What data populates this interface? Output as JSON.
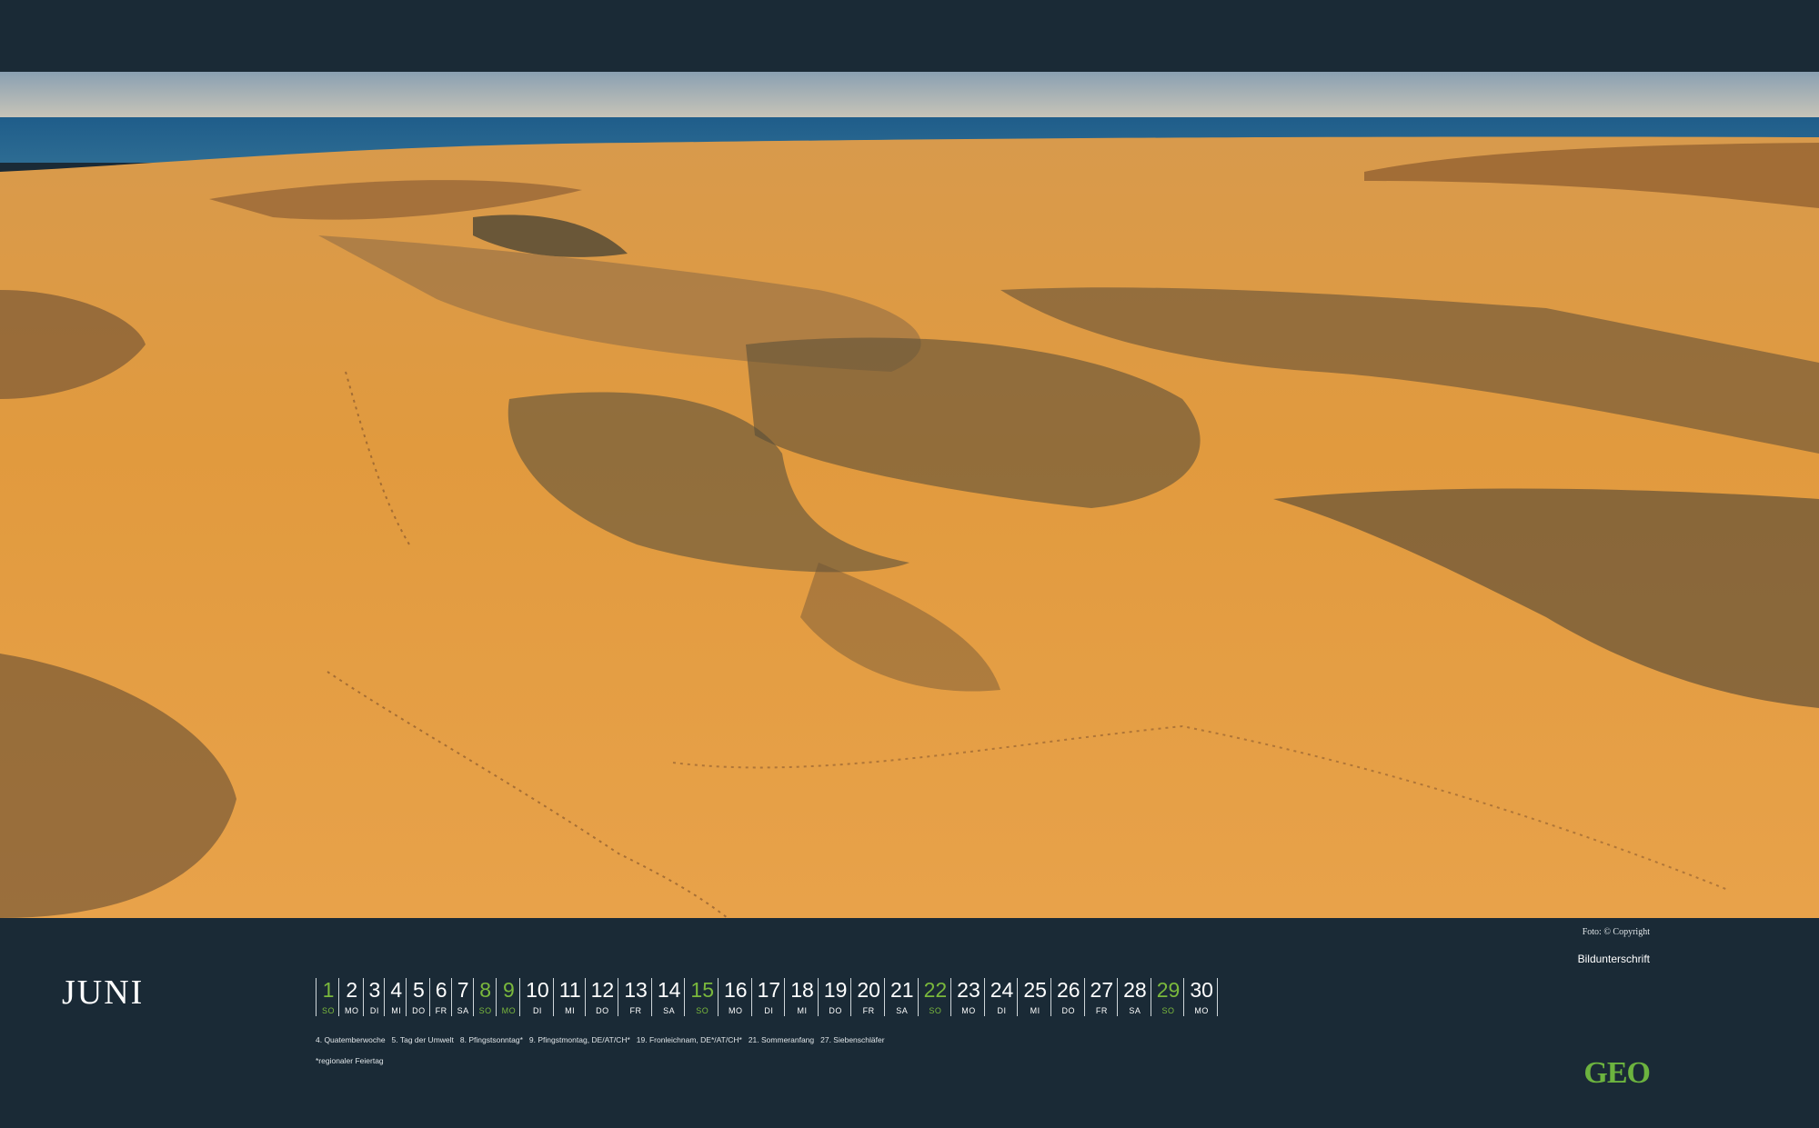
{
  "month": "JUNI",
  "photo_credit": "Foto: © Copyright",
  "caption": "Bildunterschrift",
  "logo": "GEO",
  "colors": {
    "background": "#1a2a36",
    "sunday": "#7ab83c",
    "logo": "#6cb33f"
  },
  "days": [
    {
      "n": "1",
      "wd": "SO",
      "sunday": true
    },
    {
      "n": "2",
      "wd": "MO"
    },
    {
      "n": "3",
      "wd": "DI"
    },
    {
      "n": "4",
      "wd": "MI"
    },
    {
      "n": "5",
      "wd": "DO"
    },
    {
      "n": "6",
      "wd": "FR"
    },
    {
      "n": "7",
      "wd": "SA"
    },
    {
      "n": "8",
      "wd": "SO",
      "sunday": true
    },
    {
      "n": "9",
      "wd": "MO",
      "sunday": true
    },
    {
      "n": "10",
      "wd": "DI"
    },
    {
      "n": "11",
      "wd": "MI"
    },
    {
      "n": "12",
      "wd": "DO"
    },
    {
      "n": "13",
      "wd": "FR"
    },
    {
      "n": "14",
      "wd": "SA"
    },
    {
      "n": "15",
      "wd": "SO",
      "sunday": true
    },
    {
      "n": "16",
      "wd": "MO"
    },
    {
      "n": "17",
      "wd": "DI"
    },
    {
      "n": "18",
      "wd": "MI"
    },
    {
      "n": "19",
      "wd": "DO"
    },
    {
      "n": "20",
      "wd": "FR"
    },
    {
      "n": "21",
      "wd": "SA"
    },
    {
      "n": "22",
      "wd": "SO",
      "sunday": true
    },
    {
      "n": "23",
      "wd": "MO"
    },
    {
      "n": "24",
      "wd": "DI"
    },
    {
      "n": "25",
      "wd": "MI"
    },
    {
      "n": "26",
      "wd": "DO"
    },
    {
      "n": "27",
      "wd": "FR"
    },
    {
      "n": "28",
      "wd": "SA"
    },
    {
      "n": "29",
      "wd": "SO",
      "sunday": true
    },
    {
      "n": "30",
      "wd": "MO"
    }
  ],
  "holidays": [
    "4. Quatemberwoche",
    "5. Tag der Umwelt",
    "8. Pfingstsonntag*",
    "9. Pfingstmontag, DE/AT/CH*",
    "19. Fronleichnam, DE*/AT/CH*",
    "21. Sommeranfang",
    "27. Siebenschläfer"
  ],
  "footnote": "*regionaler Feiertag"
}
